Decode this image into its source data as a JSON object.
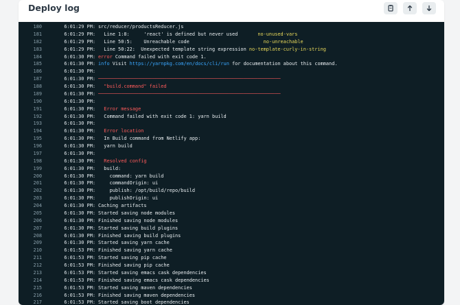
{
  "header": {
    "title": "Deploy log",
    "buttons": [
      "copy-icon",
      "arrow-up-icon",
      "arrow-down-icon"
    ]
  },
  "log_lines": [
    {
      "n": "180",
      "t": "6:01:29 PM:",
      "segs": [
        {
          "text": "src/reducer/productsReducer.js"
        }
      ]
    },
    {
      "n": "181",
      "t": "6:01:29 PM:",
      "segs": [
        {
          "text": "  Line 1:8:     'react' is defined but never used       "
        },
        {
          "text": "no-unused-vars",
          "c": "yellow"
        }
      ]
    },
    {
      "n": "182",
      "t": "6:01:29 PM:",
      "segs": [
        {
          "text": "  Line 50:5:    Unreachable code                          "
        },
        {
          "text": "no-unreachable",
          "c": "yellow"
        }
      ]
    },
    {
      "n": "183",
      "t": "6:01:29 PM:",
      "segs": [
        {
          "text": "  Line 50:22:  Unexpected template string expression "
        },
        {
          "text": "no-template-curly-in-string",
          "c": "yellow"
        }
      ]
    },
    {
      "n": "184",
      "t": "6:01:30 PM:",
      "segs": [
        {
          "text": "error",
          "c": "red"
        },
        {
          "text": " Command failed with exit code 1."
        }
      ]
    },
    {
      "n": "185",
      "t": "6:01:30 PM:",
      "segs": [
        {
          "text": "info",
          "c": "blue"
        },
        {
          "text": " Visit "
        },
        {
          "text": "https://yarnpkg.com/en/docs/cli/run",
          "c": "blue"
        },
        {
          "text": " for documentation about this command."
        }
      ]
    },
    {
      "n": "186",
      "t": "6:01:30 PM:",
      "segs": []
    },
    {
      "n": "187",
      "t": "6:01:30 PM:",
      "segs": [
        {
          "text": "────────────────────────────────────────────────────────────────",
          "c": "red"
        }
      ]
    },
    {
      "n": "188",
      "t": "6:01:30 PM:",
      "segs": [
        {
          "text": "  \"build.command\" failed",
          "c": "red"
        }
      ]
    },
    {
      "n": "189",
      "t": "6:01:30 PM:",
      "segs": [
        {
          "text": "────────────────────────────────────────────────────────────────",
          "c": "red"
        }
      ]
    },
    {
      "n": "190",
      "t": "6:01:30 PM:",
      "segs": []
    },
    {
      "n": "191",
      "t": "6:01:30 PM:",
      "segs": [
        {
          "text": "  Error message",
          "c": "red"
        }
      ]
    },
    {
      "n": "192",
      "t": "6:01:30 PM:",
      "segs": [
        {
          "text": "  Command failed with exit code 1: yarn build"
        }
      ]
    },
    {
      "n": "193",
      "t": "6:01:30 PM:",
      "segs": []
    },
    {
      "n": "194",
      "t": "6:01:30 PM:",
      "segs": [
        {
          "text": "  Error location",
          "c": "red"
        }
      ]
    },
    {
      "n": "195",
      "t": "6:01:30 PM:",
      "segs": [
        {
          "text": "  In Build command from Netlify app:"
        }
      ]
    },
    {
      "n": "196",
      "t": "6:01:30 PM:",
      "segs": [
        {
          "text": "  yarn build"
        }
      ]
    },
    {
      "n": "197",
      "t": "6:01:30 PM:",
      "segs": []
    },
    {
      "n": "198",
      "t": "6:01:30 PM:",
      "segs": [
        {
          "text": "  Resolved config",
          "c": "red"
        }
      ]
    },
    {
      "n": "199",
      "t": "6:01:30 PM:",
      "segs": [
        {
          "text": "  build:"
        }
      ]
    },
    {
      "n": "200",
      "t": "6:01:30 PM:",
      "segs": [
        {
          "text": "    command: yarn build"
        }
      ]
    },
    {
      "n": "201",
      "t": "6:01:30 PM:",
      "segs": [
        {
          "text": "    commandOrigin: ui"
        }
      ]
    },
    {
      "n": "202",
      "t": "6:01:30 PM:",
      "segs": [
        {
          "text": "    publish: /opt/build/repo/build"
        }
      ]
    },
    {
      "n": "203",
      "t": "6:01:30 PM:",
      "segs": [
        {
          "text": "    publishOrigin: ui"
        }
      ]
    },
    {
      "n": "204",
      "t": "6:01:30 PM:",
      "segs": [
        {
          "text": "Caching artifacts"
        }
      ]
    },
    {
      "n": "205",
      "t": "6:01:30 PM:",
      "segs": [
        {
          "text": "Started saving node modules"
        }
      ]
    },
    {
      "n": "206",
      "t": "6:01:30 PM:",
      "segs": [
        {
          "text": "Finished saving node modules"
        }
      ]
    },
    {
      "n": "207",
      "t": "6:01:30 PM:",
      "segs": [
        {
          "text": "Started saving build plugins"
        }
      ]
    },
    {
      "n": "208",
      "t": "6:01:30 PM:",
      "segs": [
        {
          "text": "Finished saving build plugins"
        }
      ]
    },
    {
      "n": "209",
      "t": "6:01:30 PM:",
      "segs": [
        {
          "text": "Started saving yarn cache"
        }
      ]
    },
    {
      "n": "210",
      "t": "6:01:53 PM:",
      "segs": [
        {
          "text": "Finished saving yarn cache"
        }
      ]
    },
    {
      "n": "211",
      "t": "6:01:53 PM:",
      "segs": [
        {
          "text": "Started saving pip cache"
        }
      ]
    },
    {
      "n": "212",
      "t": "6:01:53 PM:",
      "segs": [
        {
          "text": "Finished saving pip cache"
        }
      ]
    },
    {
      "n": "213",
      "t": "6:01:53 PM:",
      "segs": [
        {
          "text": "Started saving emacs cask dependencies"
        }
      ]
    },
    {
      "n": "214",
      "t": "6:01:53 PM:",
      "segs": [
        {
          "text": "Finished saving emacs cask dependencies"
        }
      ]
    },
    {
      "n": "215",
      "t": "6:01:53 PM:",
      "segs": [
        {
          "text": "Started saving maven dependencies"
        }
      ]
    },
    {
      "n": "216",
      "t": "6:01:53 PM:",
      "segs": [
        {
          "text": "Finished saving maven dependencies"
        }
      ]
    },
    {
      "n": "217",
      "t": "6:01:53 PM:",
      "segs": [
        {
          "text": "Started saving boot dependencies"
        }
      ]
    }
  ],
  "colors": {
    "log_bg": "#0e1e25",
    "error_red": "#ff5b5b",
    "info_blue": "#3aa7ff",
    "lint_yellow": "#e8d85a"
  }
}
